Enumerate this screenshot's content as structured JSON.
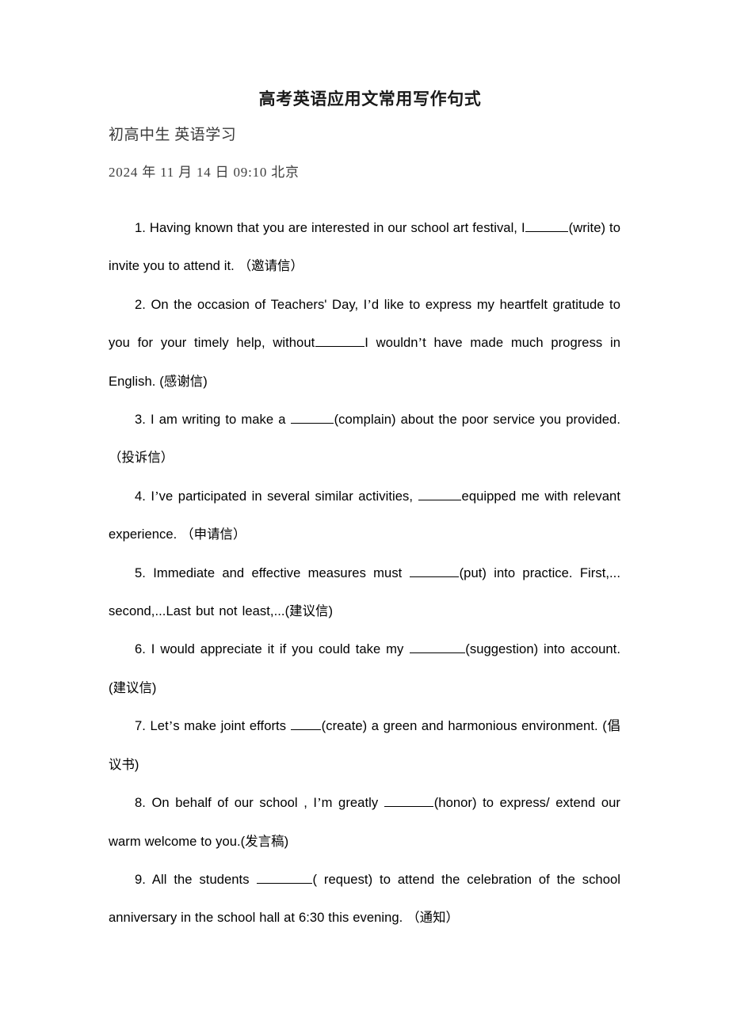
{
  "document": {
    "title": "高考英语应用文常用写作句式",
    "subtitle": "初高中生 英语学习",
    "datetime": "2024 年 11 月 14 日  09:10  北京",
    "items": [
      {
        "number": "1.",
        "before_blank": "Having known that you are interested in our school art festival, I",
        "after_blank": "(write)    to invite you to attend it. （邀请信）",
        "tag": "（邀请信）",
        "cue": "(write)"
      },
      {
        "number": "2.",
        "before_blank": "On the occasion of Teachers' Day, I’d like to express my heartfelt gratitude to you for your timely help, without",
        "after_blank": "I wouldn’t have made much progress in English. (感谢信)",
        "tag": "(感谢信)",
        "cue": ""
      },
      {
        "number": "3.",
        "before_blank": "I am writing to make a",
        "after_blank": "(complain) about the poor service you provided.（投诉信）",
        "tag": "（投诉信）",
        "cue": "(complain)"
      },
      {
        "number": "4.",
        "before_blank": "I’ve participated in several similar activities,",
        "after_blank": "equipped me with relevant experience. （申请信）",
        "tag": "（申请信）",
        "cue": ""
      },
      {
        "number": "5.",
        "before_blank": "Immediate and effective measures must",
        "after_blank": "(put) into practice. First,... second,...Last but not least,...(建议信)",
        "tag": "(建议信)",
        "cue": "(put)"
      },
      {
        "number": "6.",
        "before_blank": "I would appreciate it if you could take my",
        "after_blank": "(suggestion) into account. (建议信)",
        "tag": "(建议信)",
        "cue": "(suggestion)"
      },
      {
        "number": "7.",
        "before_blank": "Let’s make joint efforts",
        "after_blank": "(create)    a green and harmonious environment. (倡议书)",
        "tag": "(倡议书)",
        "cue": "(create)"
      },
      {
        "number": "8.",
        "before_blank": "On behalf of our school , I’m greatly",
        "after_blank": "(honor) to express/ extend our warm welcome to you.(发言稿)",
        "tag": "(发言稿)",
        "cue": "(honor)"
      },
      {
        "number": "9.",
        "before_blank": "All the students",
        "after_blank": "( request) to attend the celebration of the school anniversary in the school hall at 6:30 this evening. （通知）",
        "tag": "（通知）",
        "cue": "( request)"
      }
    ],
    "fragments": {
      "i1a": "1. Having known that you are interested in our school art festival, I",
      "i1b": "(write)    to invite you to attend it. ",
      "i1c": "（邀请信）",
      "i2a": "2. On the occasion of Teachers' Day, I",
      "i2b": "d like to express my heartfelt gratitude to you for your timely help, without",
      "i2c": "I wouldn",
      "i2d": "t have made much progress in English. (",
      "i2e": "感谢信",
      "i2f": ")",
      "i3a": "3. I am writing to make a ",
      "i3b": "(complain) about the poor service you provided.",
      "i3c": "（投诉信）",
      "i4a": "4. I",
      "i4b": "ve participated in several similar activities, ",
      "i4c": "equipped me with relevant experience. ",
      "i4d": "（申请信）",
      "i5a": "5.  Immediate  and  effective  measures  must  ",
      "i5b": "(put)  into practice. First,... second,...Last but not least,...(",
      "i5c": "建议信",
      "i5d": ")",
      "i6a": "6. I would appreciate it if you could take my ",
      "i6b": "(suggestion) into account. (",
      "i6c": "建议信",
      "i6d": ")",
      "i7a": "7. Let",
      "i7b": "s make joint efforts ",
      "i7c": "(create)    a green and harmonious environment. (",
      "i7d": "倡议书",
      "i7e": ")",
      "i8a": "8. On behalf of our school , I",
      "i8b": "m greatly ",
      "i8c": "(honor) to express/ extend our warm welcome to you.(",
      "i8d": "发言稿",
      "i8e": ")",
      "i9a": "9. All the students ",
      "i9b": "( request) to attend the celebration of the school anniversary in the school hall at 6:30 this evening. ",
      "i9c": "（通知）",
      "apostrophe": "’"
    }
  }
}
